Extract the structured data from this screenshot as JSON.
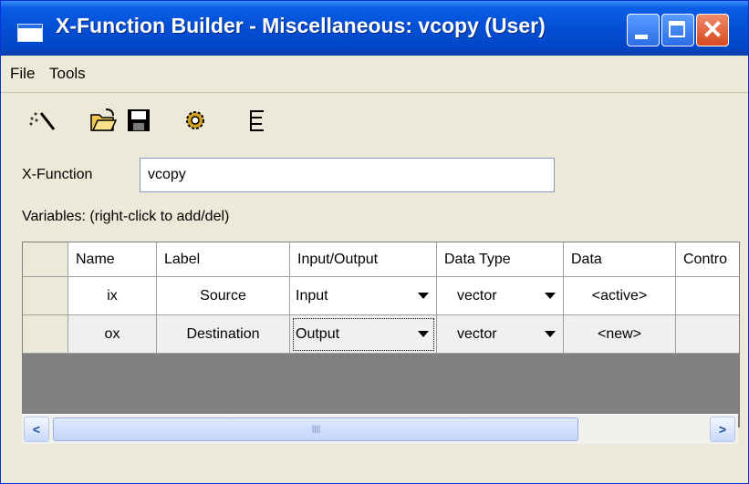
{
  "window": {
    "title": "X-Function Builder - Miscellaneous: vcopy (User)",
    "title_bar_color": "#0450d6",
    "close_button_color": "#d64a20"
  },
  "menu": {
    "items": [
      "File",
      "Tools"
    ]
  },
  "toolbar": {
    "icons": [
      "new-wand-icon",
      "open-folder-icon",
      "save-disk-icon",
      "settings-gear-icon",
      "tree-view-icon"
    ]
  },
  "form": {
    "xfunction_label": "X-Function",
    "xfunction_value": "vcopy",
    "variables_label": "Variables: (right-click to add/del)"
  },
  "table": {
    "columns": [
      "Name",
      "Label",
      "Input/Output",
      "Data Type",
      "Data",
      "Contro"
    ],
    "rows": [
      {
        "name": "ix",
        "label": "Source",
        "io": "Input",
        "type": "vector",
        "data": "<active>",
        "control": ""
      },
      {
        "name": "ox",
        "label": "Destination",
        "io": "Output",
        "type": "vector",
        "data": "<new>",
        "control": ""
      }
    ]
  },
  "scrollbar": {
    "thumb_grip": "IIII"
  }
}
